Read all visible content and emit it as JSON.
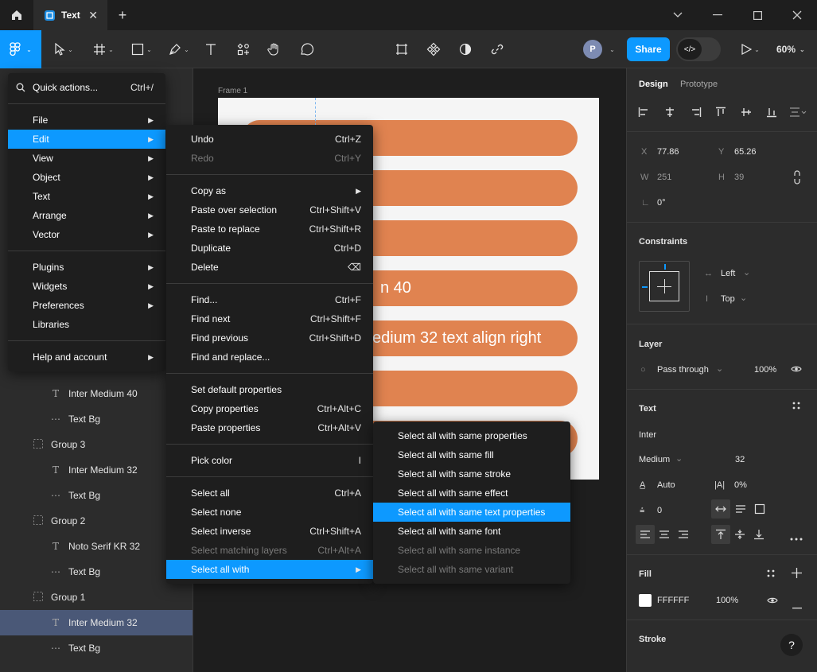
{
  "tab": {
    "title": "Text"
  },
  "toolbar": {
    "avatar_initial": "P",
    "share_label": "Share",
    "zoom": "60%"
  },
  "canvas": {
    "frame_label": "Frame 1",
    "pills": [
      "",
      "",
      "",
      "n 40",
      "edium 32 text align right",
      "",
      ""
    ]
  },
  "layers": [
    {
      "icon": "text",
      "label": "Inter Medium 40",
      "indent": 2
    },
    {
      "icon": "line",
      "label": "Text Bg",
      "indent": 2
    },
    {
      "icon": "group",
      "label": "Group 3",
      "indent": 1
    },
    {
      "icon": "text",
      "label": "Inter Medium 32",
      "indent": 2
    },
    {
      "icon": "line",
      "label": "Text Bg",
      "indent": 2
    },
    {
      "icon": "group",
      "label": "Group 2",
      "indent": 1
    },
    {
      "icon": "text",
      "label": "Noto Serif KR 32",
      "indent": 2
    },
    {
      "icon": "line",
      "label": "Text Bg",
      "indent": 2
    },
    {
      "icon": "group",
      "label": "Group 1",
      "indent": 1
    },
    {
      "icon": "text",
      "label": "Inter Medium 32",
      "indent": 2,
      "selected": true
    },
    {
      "icon": "line",
      "label": "Text Bg",
      "indent": 2
    }
  ],
  "main_menu": {
    "quick_actions": {
      "label": "Quick actions...",
      "shortcut": "Ctrl+/"
    },
    "groups": [
      [
        {
          "label": "File",
          "sub": true
        },
        {
          "label": "Edit",
          "sub": true,
          "active": true
        },
        {
          "label": "View",
          "sub": true
        },
        {
          "label": "Object",
          "sub": true
        },
        {
          "label": "Text",
          "sub": true
        },
        {
          "label": "Arrange",
          "sub": true
        },
        {
          "label": "Vector",
          "sub": true
        }
      ],
      [
        {
          "label": "Plugins",
          "sub": true
        },
        {
          "label": "Widgets",
          "sub": true
        },
        {
          "label": "Preferences",
          "sub": true
        },
        {
          "label": "Libraries",
          "sub": false
        }
      ],
      [
        {
          "label": "Help and account",
          "sub": true
        }
      ]
    ]
  },
  "edit_menu": [
    [
      {
        "label": "Undo",
        "shortcut": "Ctrl+Z"
      },
      {
        "label": "Redo",
        "shortcut": "Ctrl+Y",
        "disabled": true
      }
    ],
    [
      {
        "label": "Copy as",
        "sub": true
      },
      {
        "label": "Paste over selection",
        "shortcut": "Ctrl+Shift+V"
      },
      {
        "label": "Paste to replace",
        "shortcut": "Ctrl+Shift+R"
      },
      {
        "label": "Duplicate",
        "shortcut": "Ctrl+D"
      },
      {
        "label": "Delete",
        "shortcut": "⌫"
      }
    ],
    [
      {
        "label": "Find...",
        "shortcut": "Ctrl+F"
      },
      {
        "label": "Find next",
        "shortcut": "Ctrl+Shift+F"
      },
      {
        "label": "Find previous",
        "shortcut": "Ctrl+Shift+D"
      },
      {
        "label": "Find and replace..."
      }
    ],
    [
      {
        "label": "Set default properties"
      },
      {
        "label": "Copy properties",
        "shortcut": "Ctrl+Alt+C"
      },
      {
        "label": "Paste properties",
        "shortcut": "Ctrl+Alt+V"
      }
    ],
    [
      {
        "label": "Pick color",
        "shortcut": "I"
      }
    ],
    [
      {
        "label": "Select all",
        "shortcut": "Ctrl+A"
      },
      {
        "label": "Select none"
      },
      {
        "label": "Select inverse",
        "shortcut": "Ctrl+Shift+A"
      },
      {
        "label": "Select matching layers",
        "shortcut": "Ctrl+Alt+A",
        "disabled": true
      },
      {
        "label": "Select all with",
        "sub": true,
        "active": true
      }
    ]
  ],
  "select_all_with_menu": [
    {
      "label": "Select all with same properties"
    },
    {
      "label": "Select all with same fill"
    },
    {
      "label": "Select all with same stroke"
    },
    {
      "label": "Select all with same effect"
    },
    {
      "label": "Select all with same text properties",
      "active": true
    },
    {
      "label": "Select all with same font"
    },
    {
      "label": "Select all with same instance",
      "disabled": true
    },
    {
      "label": "Select all with same variant",
      "disabled": true
    }
  ],
  "design": {
    "tabs": {
      "design": "Design",
      "prototype": "Prototype"
    },
    "x_label": "X",
    "x": "77.86",
    "y_label": "Y",
    "y": "65.26",
    "w_label": "W",
    "w": "251",
    "h_label": "H",
    "h": "39",
    "rotation": "0°",
    "constraints_title": "Constraints",
    "constraint_h": "Left",
    "constraint_v": "Top",
    "layer_title": "Layer",
    "blend": "Pass through",
    "opacity": "100%",
    "text_title": "Text",
    "font_family": "Inter",
    "font_weight": "Medium",
    "font_size": "32",
    "line_height": "Auto",
    "letter_spacing": "0%",
    "paragraph_spacing": "0",
    "fill_title": "Fill",
    "fill_hex": "FFFFFF",
    "fill_opacity": "100%",
    "stroke_title": "Stroke",
    "help": "?"
  },
  "colors": {
    "accent": "#0d99ff",
    "pill": "#e08350",
    "selected_layer": "#4a5877"
  }
}
